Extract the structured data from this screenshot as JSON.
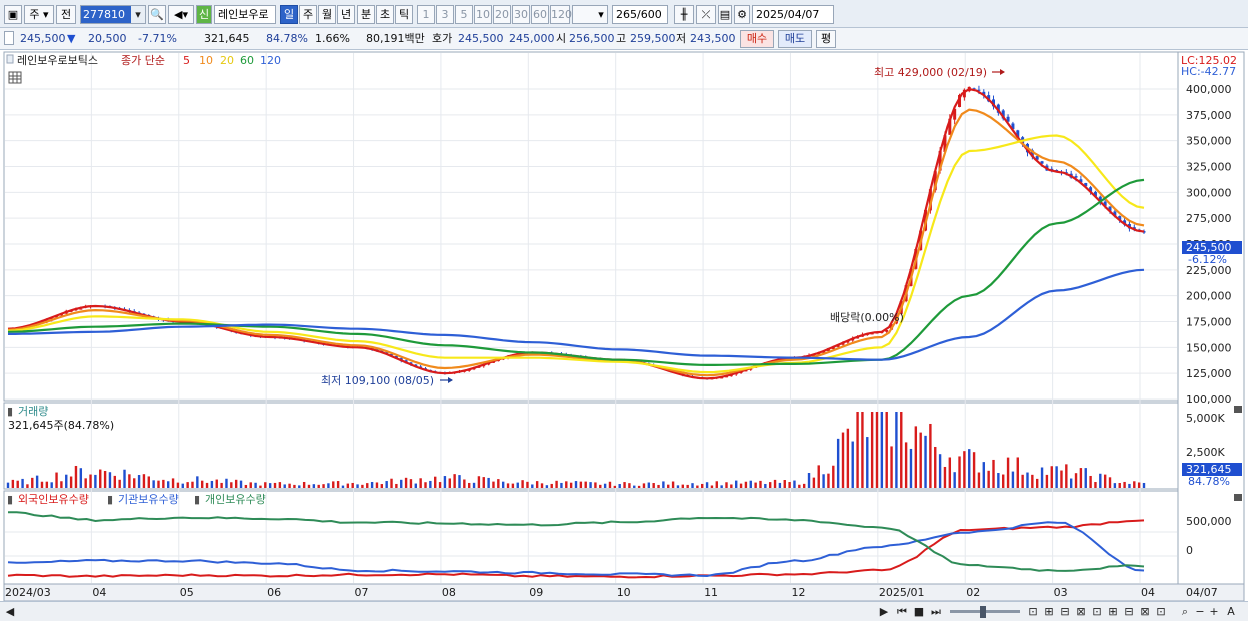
{
  "toolbar": {
    "period_label": "주",
    "prev_label": "전",
    "code": "277810",
    "new_badge": "신",
    "stock_name": "레인보우로",
    "timeframes": [
      "일",
      "주",
      "월",
      "년",
      "분",
      "초",
      "틱"
    ],
    "selected_timeframe": "일",
    "intervals": [
      "1",
      "3",
      "5",
      "10",
      "20",
      "30",
      "60",
      "120"
    ],
    "count_current": "265",
    "count_total": "/600",
    "date": "2025/04/07"
  },
  "price_info": {
    "price": "245,500",
    "change": "20,500",
    "change_pct": "-7.71%",
    "volume": "321,645",
    "volume_ratio": "84.78%",
    "turnover": "1.66%",
    "amount": "80,191백만",
    "ask_label": "호가",
    "ask": "245,500",
    "bid": "245,000",
    "open_label": "시",
    "open": "256,500",
    "high_label": "고",
    "high": "259,500",
    "low_label": "저",
    "low": "243,500",
    "buy_label": "매수",
    "sell_label": "매도",
    "eval_label": "평"
  },
  "price_panel": {
    "stock_label": "레인보우로보틱스",
    "ma_legend_label": "종가 단순",
    "ma_periods": [
      "5",
      "10",
      "20",
      "60",
      "120"
    ],
    "lc_label": "LC:125.02",
    "hc_label": "HC:-42.77",
    "high_annotation": "최고 429,000 (02/19)",
    "low_annotation": "최저 109,100 (08/05)",
    "dividend_annotation": "배당락(0.00%)",
    "current_price_tag": "245,500",
    "current_pct_tag": "-6.12%",
    "y_ticks": [
      "400,000",
      "375,000",
      "350,000",
      "325,000",
      "300,000",
      "275,000",
      "250,000",
      "225,000",
      "200,000",
      "175,000",
      "150,000",
      "125,000",
      "100,000"
    ]
  },
  "volume_panel": {
    "title": "거래량",
    "info": "321,645주(84.78%)",
    "y_ticks": [
      "5,000K",
      "2,500K"
    ],
    "current_tag": "321,645",
    "current_pct": "84.78%"
  },
  "holdings_panel": {
    "legend": [
      "외국인보유수량",
      "기관보유수량",
      "개인보유수량"
    ],
    "y_ticks": [
      "500,000",
      "0"
    ]
  },
  "x_axis": {
    "labels": [
      "2024/03",
      "04",
      "05",
      "06",
      "07",
      "08",
      "09",
      "10",
      "11",
      "12",
      "2025/01",
      "02",
      "03",
      "04",
      "04/07"
    ]
  },
  "colors": {
    "ma5": "#d81b1b",
    "ma10": "#f08a1c",
    "ma20": "#f7e81a",
    "ma60": "#1e9a3a",
    "ma120": "#2e5fd6",
    "foreign": "#d81b1b",
    "institution": "#2e5fd6",
    "individual": "#2e8b57",
    "up": "#d81b1b",
    "down": "#1f4fd0"
  },
  "chart_data": {
    "type": "line",
    "title": "레인보우로보틱스",
    "x": [
      "2024/03",
      "04",
      "05",
      "06",
      "07",
      "08",
      "09",
      "10",
      "11",
      "12",
      "2025/01",
      "02",
      "03",
      "04"
    ],
    "ylim": [
      100000,
      430000
    ],
    "series": [
      {
        "name": "5",
        "values": [
          168000,
          190000,
          175000,
          160000,
          150000,
          125000,
          145000,
          138000,
          120000,
          140000,
          165000,
          400000,
          320000,
          262000
        ]
      },
      {
        "name": "10",
        "values": [
          167000,
          186000,
          176000,
          162000,
          152000,
          130000,
          143000,
          137000,
          123000,
          138000,
          160000,
          380000,
          330000,
          268000
        ]
      },
      {
        "name": "20",
        "values": [
          166000,
          180000,
          177000,
          165000,
          156000,
          140000,
          140000,
          136000,
          126000,
          135000,
          150000,
          340000,
          355000,
          285000
        ]
      },
      {
        "name": "60",
        "values": [
          165000,
          170000,
          173000,
          170000,
          163000,
          152000,
          145000,
          138000,
          133000,
          134000,
          138000,
          200000,
          270000,
          312000
        ]
      },
      {
        "name": "120",
        "values": [
          163000,
          165000,
          170000,
          172000,
          168000,
          162000,
          155000,
          148000,
          142000,
          140000,
          138000,
          160000,
          205000,
          225000
        ]
      }
    ],
    "volume_values": [
      400000,
      1200000,
      600000,
      300000,
      350000,
      700000,
      400000,
      300000,
      350000,
      400000,
      5200000,
      2000000,
      1200000,
      321645
    ],
    "holdings": [
      {
        "name": "외국인보유수량",
        "values": [
          -400000,
          -420000,
          -400000,
          -410000,
          -390000,
          -380000,
          -420000,
          -430000,
          -410000,
          -380000,
          -300000,
          550000,
          600000,
          750000
        ]
      },
      {
        "name": "기관보유수량",
        "values": [
          -150000,
          -100000,
          -100000,
          -150000,
          -300000,
          -320000,
          -350000,
          -380000,
          -400000,
          -100000,
          200000,
          500000,
          700000,
          -300000
        ]
      },
      {
        "name": "개인보유수량",
        "values": [
          900000,
          750000,
          800000,
          780000,
          700000,
          680000,
          650000,
          700000,
          800000,
          750000,
          600000,
          -200000,
          -300000,
          -200000
        ]
      }
    ]
  }
}
